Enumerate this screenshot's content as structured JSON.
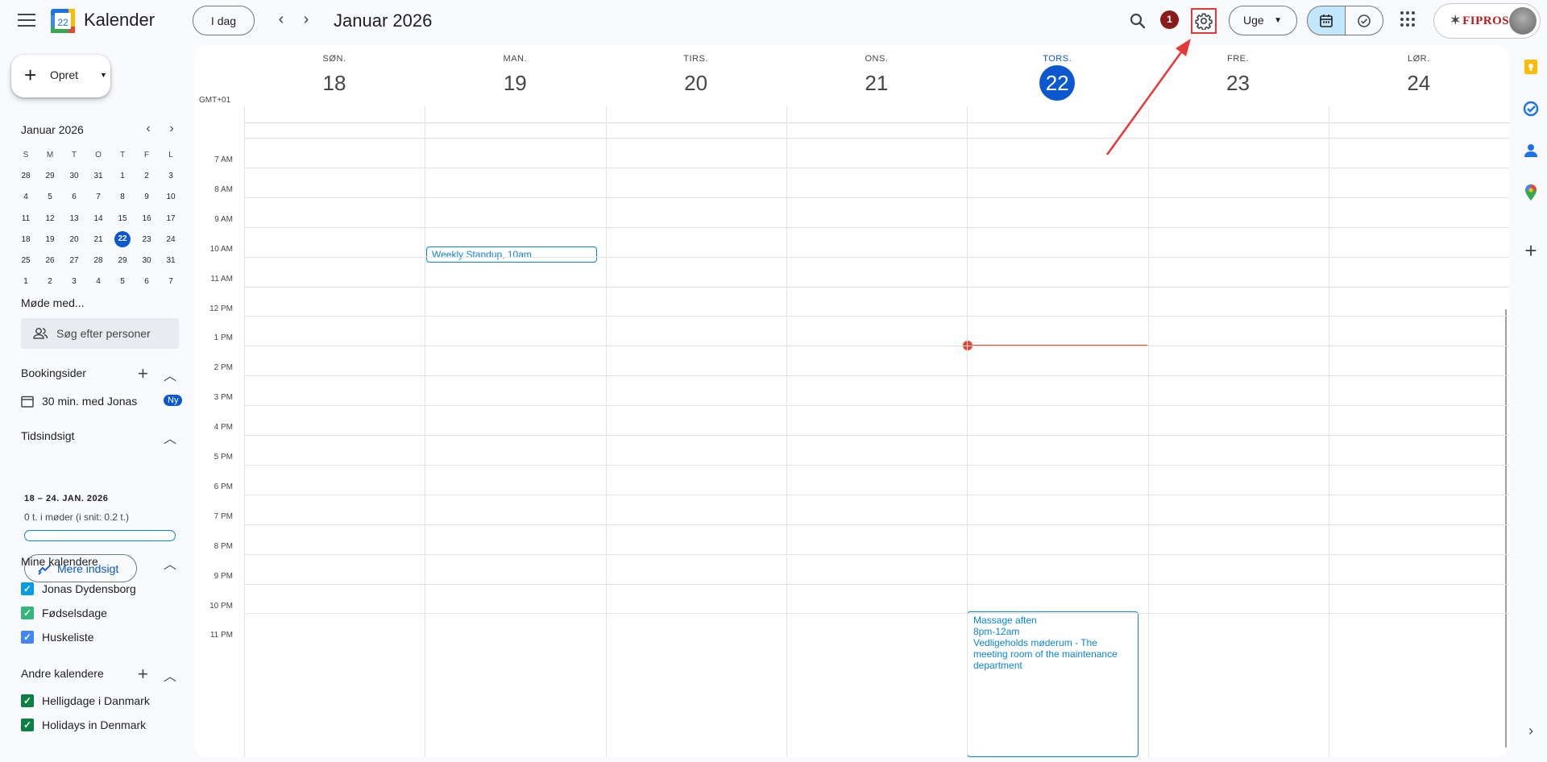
{
  "app": {
    "title": "Kalender",
    "logo_day": "22"
  },
  "header": {
    "today_label": "I dag",
    "period_title": "Januar 2026",
    "notification_count": "1",
    "view_label": "Uge",
    "org_name": "FIPROS"
  },
  "sidebar": {
    "create_label": "Opret",
    "mini_calendar": {
      "title": "Januar 2026",
      "weekdays": [
        "S",
        "M",
        "T",
        "O",
        "T",
        "F",
        "L"
      ],
      "weeks": [
        [
          "28",
          "29",
          "30",
          "31",
          "1",
          "2",
          "3"
        ],
        [
          "4",
          "5",
          "6",
          "7",
          "8",
          "9",
          "10"
        ],
        [
          "11",
          "12",
          "13",
          "14",
          "15",
          "16",
          "17"
        ],
        [
          "18",
          "19",
          "20",
          "21",
          "22",
          "23",
          "24"
        ],
        [
          "25",
          "26",
          "27",
          "28",
          "29",
          "30",
          "31"
        ],
        [
          "1",
          "2",
          "3",
          "4",
          "5",
          "6",
          "7"
        ]
      ],
      "today": "22"
    },
    "meet_title": "Møde med...",
    "people_search_placeholder": "Søg efter personer",
    "booking_title": "Bookingsider",
    "booking_item": "30 min. med Jonas",
    "booking_badge": "Ny",
    "insight_title": "Tidsindsigt",
    "insight_range": "18 – 24. JAN. 2026",
    "insight_stat": "0 t. i møder (i snit: 0.2 t.)",
    "insight_progress": 0,
    "more_insight_label": "Mere indsigt",
    "my_calendars_title": "Mine kalendere",
    "my_calendars": [
      "Jonas Dydensborg",
      "Fødselsdage",
      "Huskeliste"
    ],
    "other_calendars_title": "Andre kalendere",
    "other_calendars": [
      "Helligdage i Danmark",
      "Holidays in Denmark"
    ]
  },
  "week": {
    "timezone": "GMT+01",
    "days": [
      {
        "name": "SØN.",
        "date": "18"
      },
      {
        "name": "MAN.",
        "date": "19"
      },
      {
        "name": "TIRS.",
        "date": "20"
      },
      {
        "name": "ONS.",
        "date": "21"
      },
      {
        "name": "TORS.",
        "date": "22"
      },
      {
        "name": "FRE.",
        "date": "23"
      },
      {
        "name": "LØR.",
        "date": "24"
      }
    ],
    "hours": [
      "7 AM",
      "8 AM",
      "9 AM",
      "10 AM",
      "11 AM",
      "12 PM",
      "1 PM",
      "2 PM",
      "3 PM",
      "4 PM",
      "5 PM",
      "6 PM",
      "7 PM",
      "8 PM",
      "9 PM",
      "10 PM",
      "11 PM"
    ]
  },
  "events": {
    "standup": {
      "title": "Weekly Standup",
      "time": "10am"
    },
    "massage": {
      "title": "Massage aften",
      "time": "8pm-12am",
      "location": "Vedligeholds møderum - The meeting room of the maintenance department"
    }
  },
  "colors": {
    "accent": "#0b57d0",
    "event": "#0b84d8",
    "now": "#ea4335",
    "annotation": "#e53935"
  }
}
